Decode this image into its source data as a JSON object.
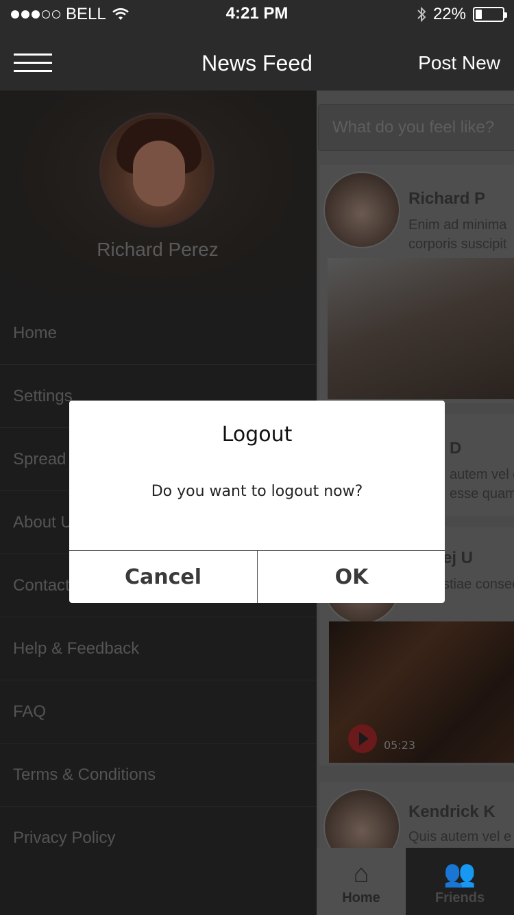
{
  "status_bar": {
    "carrier": "BELL",
    "time": "4:21 PM",
    "battery": "22%"
  },
  "nav": {
    "title": "News Feed",
    "post_new": "Post New"
  },
  "profile": {
    "name": "Richard Perez"
  },
  "menu": {
    "items": [
      {
        "label": "Home"
      },
      {
        "label": "Settings"
      },
      {
        "label": "Spread"
      },
      {
        "label": "About U"
      },
      {
        "label": "Contact"
      },
      {
        "label": "Help & Feedback"
      },
      {
        "label": "FAQ"
      },
      {
        "label": "Terms &  Conditions"
      },
      {
        "label": "Privacy Policy"
      }
    ]
  },
  "feed": {
    "search_placeholder": "What do you feel like?",
    "posts": [
      {
        "name": "Richard P",
        "line1": "Enim ad minima",
        "line2": "corporis suscipit"
      },
      {
        "name": "D",
        "line1": "autem vel e",
        "line2": "esse quam n"
      },
      {
        "name": "ej U",
        "line1": "stiae consec",
        "duration": "05:23"
      },
      {
        "name": "Kendrick K",
        "line1": "Quis autem vel e"
      }
    ]
  },
  "tabs": {
    "home": "Home",
    "friends": "Friends"
  },
  "alert": {
    "title": "Logout",
    "message": "Do you want to logout now?",
    "cancel": "Cancel",
    "ok": "OK"
  }
}
